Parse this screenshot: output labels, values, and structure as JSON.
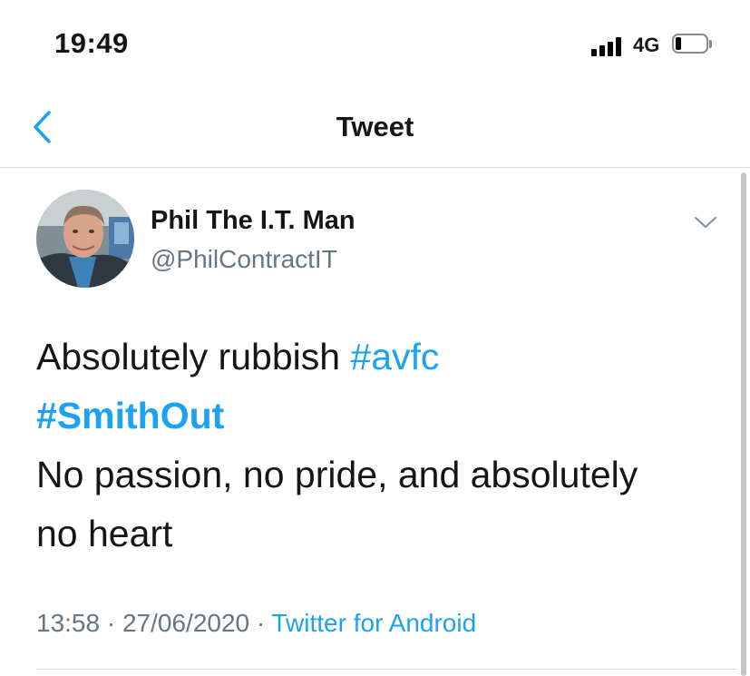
{
  "status_bar": {
    "time": "19:49",
    "network": "4G",
    "signal_bars": 4,
    "battery_level": 0.2
  },
  "nav": {
    "title": "Tweet",
    "back_icon": "chevron-left-icon"
  },
  "tweet": {
    "author": {
      "display_name": "Phil The I.T. Man",
      "handle": "@PhilContractIT",
      "avatar_icon": "profile-photo"
    },
    "menu_icon": "chevron-down-icon",
    "text": {
      "line1_text": "Absolutely rubbish ",
      "line1_hashtag": "#avfc",
      "line2_hashtag": "#SmithOut",
      "line3": "No passion, no pride, and absolutely",
      "line4": "no heart"
    },
    "time": "13:58",
    "separator": " · ",
    "date": "27/06/2020",
    "source": "Twitter for Android"
  },
  "colors": {
    "accent": "#1da1f2",
    "secondary_text": "#657786",
    "primary_text": "#14171a",
    "divider": "#d8dde1"
  }
}
